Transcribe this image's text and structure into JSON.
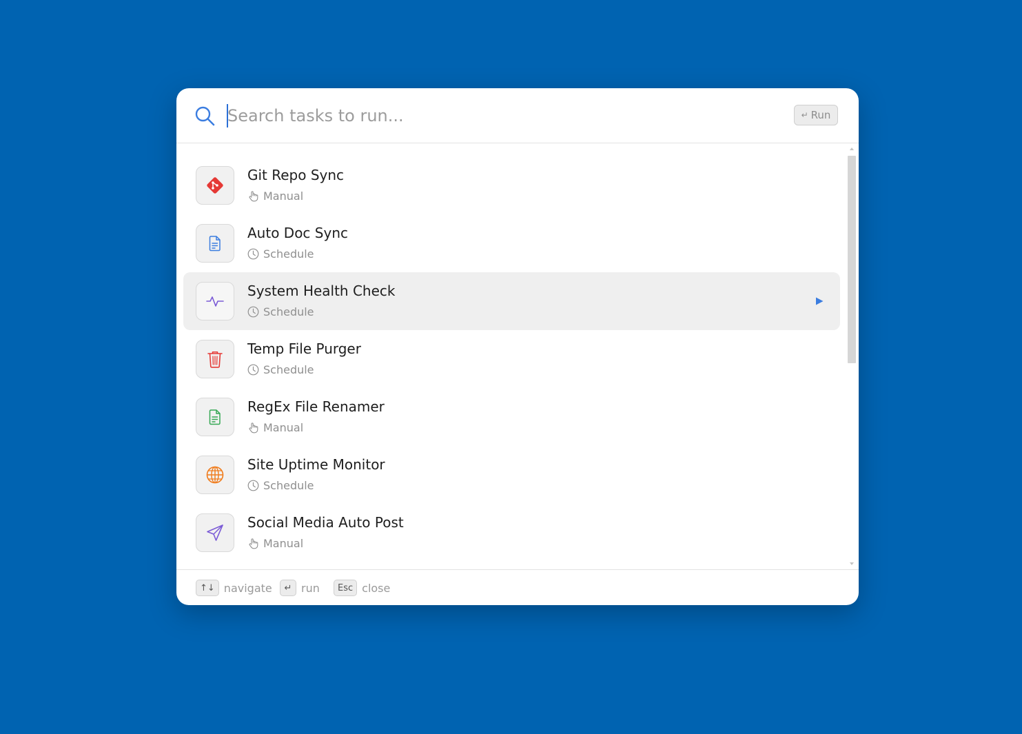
{
  "search": {
    "placeholder": "Search tasks to run...",
    "value": "",
    "run_badge": {
      "key": "↵",
      "label": "Run"
    }
  },
  "tasks": [
    {
      "title": "Git Repo Sync",
      "trigger": "Manual",
      "icon": "git-icon",
      "color": "#e53935"
    },
    {
      "title": "Auto Doc Sync",
      "trigger": "Schedule",
      "icon": "document-icon",
      "color": "#3b7de0"
    },
    {
      "title": "System Health Check",
      "trigger": "Schedule",
      "icon": "activity-icon",
      "color": "#7b5bd6",
      "selected": true
    },
    {
      "title": "Temp File Purger",
      "trigger": "Schedule",
      "icon": "trash-icon",
      "color": "#e53935"
    },
    {
      "title": "RegEx File Renamer",
      "trigger": "Manual",
      "icon": "file-text-icon",
      "color": "#34a853"
    },
    {
      "title": "Site Uptime Monitor",
      "trigger": "Schedule",
      "icon": "globe-icon",
      "color": "#f07b1a"
    },
    {
      "title": "Social Media Auto Post",
      "trigger": "Manual",
      "icon": "send-icon",
      "color": "#7b5bd6"
    }
  ],
  "footer": {
    "navigate": {
      "key": "↑↓",
      "label": "navigate"
    },
    "run": {
      "key": "↵",
      "label": "run"
    },
    "close": {
      "key": "Esc",
      "label": "close"
    }
  },
  "colors": {
    "background": "#0063b1",
    "accent": "#2b6fd6",
    "selected_row": "#efefef",
    "play": "#3b7de0"
  }
}
